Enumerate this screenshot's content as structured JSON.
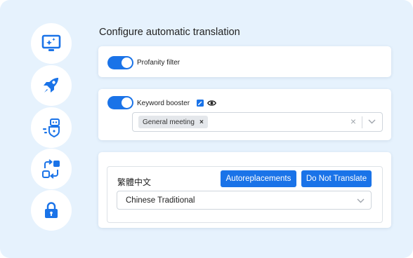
{
  "page": {
    "title": "Configure automatic translation"
  },
  "rail": {
    "icons": [
      {
        "name": "monitor-sparkle-icon"
      },
      {
        "name": "rocket-icon"
      },
      {
        "name": "robot-shield-icon"
      },
      {
        "name": "swap-arrows-icon"
      },
      {
        "name": "lock-icon"
      }
    ]
  },
  "profanity": {
    "label": "Profanity filter",
    "enabled": true
  },
  "keyword": {
    "label": "Keyword booster",
    "enabled": true,
    "chip": "General meeting",
    "chip_remove": "×",
    "clear": "×"
  },
  "language": {
    "native_name": "繁體中文",
    "autoreplacements_label": "Autoreplacements",
    "do_not_translate_label": "Do Not Translate",
    "selected": "Chinese Traditional"
  },
  "colors": {
    "accent": "#1a73e8",
    "panel": "#e6f2fd"
  }
}
